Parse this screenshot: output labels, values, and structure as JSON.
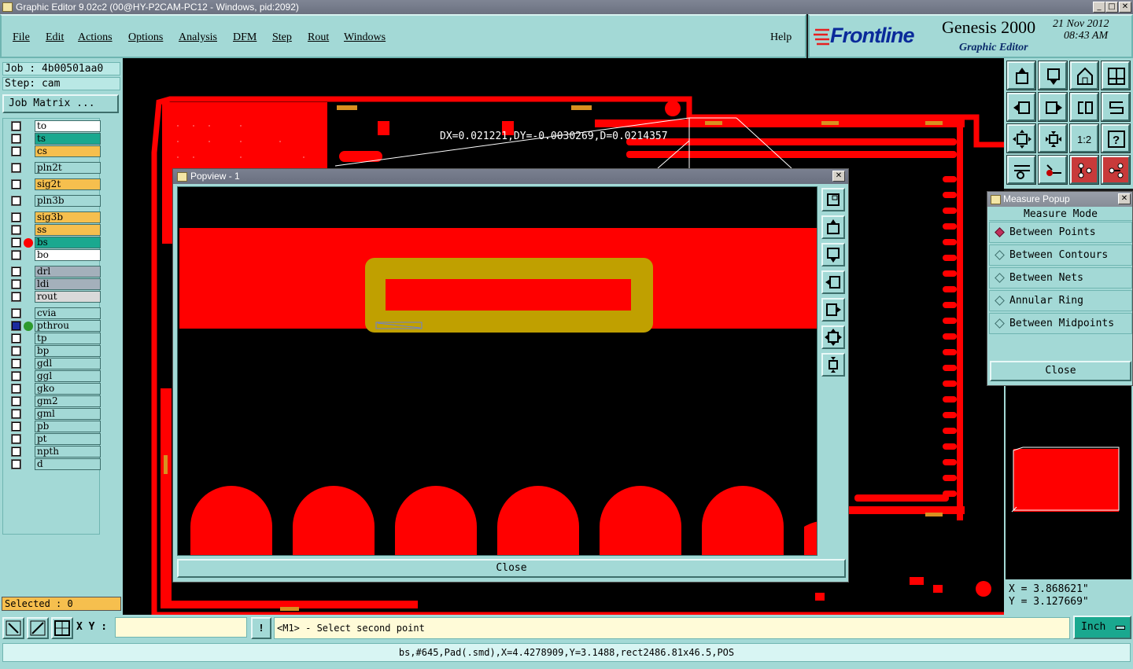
{
  "window": {
    "title": "Graphic Editor 9.02c2 (00@HY-P2CAM-PC12 - Windows, pid:2092)",
    "min": "_",
    "max": "□",
    "close": "✕"
  },
  "menu": [
    "File",
    "Edit",
    "Actions",
    "Options",
    "Analysis",
    "DFM",
    "Step",
    "Rout",
    "Windows"
  ],
  "help": "Help",
  "brand": {
    "logo": "Frontline",
    "product": "Genesis 2000",
    "subtitle": "Graphic Editor",
    "date": "21 Nov 2012",
    "time": "08:43 AM"
  },
  "job": "Job : 4b00501aa0",
  "step": "Step: cam",
  "job_matrix": "Job Matrix ...",
  "layers": [
    {
      "name": "to",
      "color": "#ffffff",
      "group": 0
    },
    {
      "name": "ts",
      "color": "#1aa88f",
      "group": 0
    },
    {
      "name": "cs",
      "color": "#f6bf4e",
      "group": 0
    },
    {
      "name": "pln2t",
      "color": "#a3d9d6",
      "group": 1
    },
    {
      "name": "sig2t",
      "color": "#f6bf4e",
      "group": 2
    },
    {
      "name": "pln3b",
      "color": "#a3d9d6",
      "group": 3
    },
    {
      "name": "sig3b",
      "color": "#f6bf4e",
      "group": 4
    },
    {
      "name": "ss",
      "color": "#f6bf4e",
      "group": 4
    },
    {
      "name": "bs",
      "color": "#1aa88f",
      "group": 4,
      "active": "red"
    },
    {
      "name": "bo",
      "color": "#ffffff",
      "group": 4
    },
    {
      "name": "drl",
      "color": "#a4b0bb",
      "group": 5
    },
    {
      "name": "ldi",
      "color": "#a4b0bb",
      "group": 5
    },
    {
      "name": "rout",
      "color": "#d9d9d9",
      "group": 5
    },
    {
      "name": "cvia",
      "color": "#a3d9d6",
      "group": 6
    },
    {
      "name": "pthrou",
      "color": "#a3d9d6",
      "group": 6,
      "active": "green"
    },
    {
      "name": "tp",
      "color": "#a3d9d6",
      "group": 6
    },
    {
      "name": "bp",
      "color": "#a3d9d6",
      "group": 6
    },
    {
      "name": "gdl",
      "color": "#a3d9d6",
      "group": 6
    },
    {
      "name": "ggl",
      "color": "#a3d9d6",
      "group": 6
    },
    {
      "name": "gko",
      "color": "#a3d9d6",
      "group": 6
    },
    {
      "name": "gm2",
      "color": "#a3d9d6",
      "group": 6
    },
    {
      "name": "gml",
      "color": "#a3d9d6",
      "group": 6
    },
    {
      "name": "pb",
      "color": "#a3d9d6",
      "group": 6
    },
    {
      "name": "pt",
      "color": "#a3d9d6",
      "group": 6
    },
    {
      "name": "npth",
      "color": "#a3d9d6",
      "group": 6
    },
    {
      "name": "d",
      "color": "#a3d9d6",
      "group": 6
    }
  ],
  "selected": "Selected : 0",
  "measure_readout": "DX=0.021221,DY=-0.0030269,D=0.0214357",
  "popview": {
    "title": "Popview - 1",
    "close": "Close"
  },
  "measure_popup": {
    "title": "Measure Popup",
    "heading": "Measure Mode",
    "options": [
      "Between Points",
      "Between Contours",
      "Between Nets",
      "Annular Ring",
      "Between Midpoints"
    ],
    "selected": "Between Points",
    "close": "Close"
  },
  "coords": {
    "x": "X = 3.868621\"",
    "y": "Y = 3.127669\""
  },
  "bottom": {
    "xy_label": "X Y :",
    "xy_value": "",
    "prompt": "<M1> - Select second point",
    "units": "Inch",
    "status": "bs,#645,Pad(.smd),X=4.4278909,Y=3.1488,rect2486.81x46.5,POS"
  },
  "colors": {
    "accent": "#a3d9d6",
    "pcb_red": "#ff0000",
    "highlight": "#c0a000",
    "selection_yellow": "#f6bf4e"
  }
}
